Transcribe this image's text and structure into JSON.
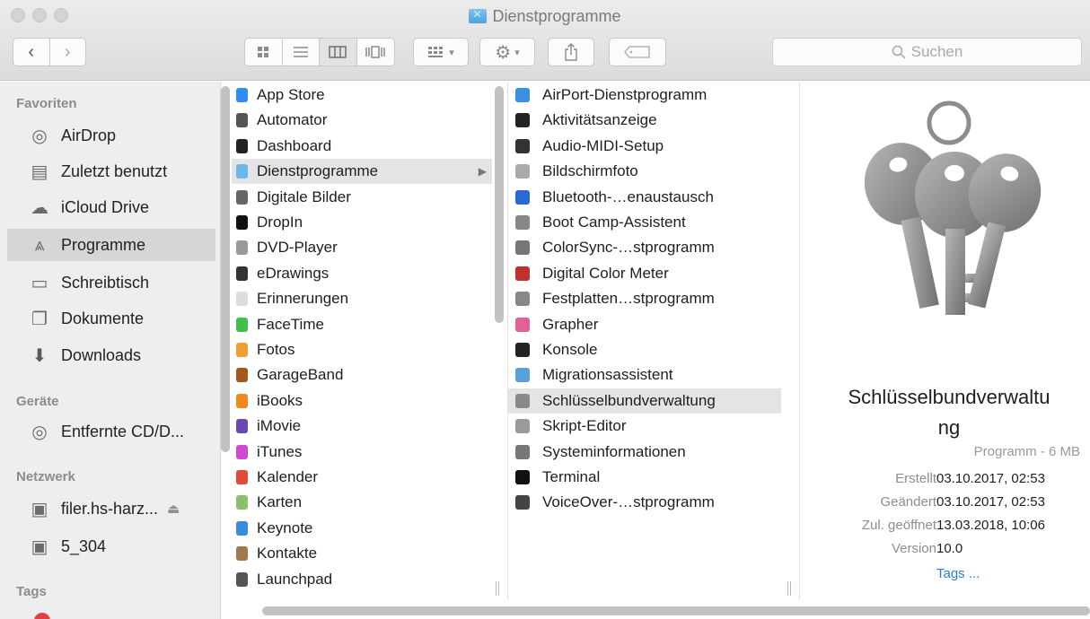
{
  "window": {
    "title": "Dienstprogramme"
  },
  "toolbar": {
    "search_placeholder": "Suchen",
    "view_modes": [
      "icon-view-icon",
      "list-view-icon",
      "column-view-icon",
      "coverflow-view-icon"
    ],
    "active_view": "column-view-icon"
  },
  "sidebar": {
    "sections": {
      "favorites": "Favoriten",
      "devices": "Geräte",
      "network": "Netzwerk",
      "tags": "Tags"
    },
    "favorites": [
      {
        "label": "AirDrop",
        "icon": "airdrop-icon"
      },
      {
        "label": "Zuletzt benutzt",
        "icon": "recents-icon"
      },
      {
        "label": "iCloud Drive",
        "icon": "cloud-icon"
      },
      {
        "label": "Programme",
        "icon": "applications-icon",
        "selected": true
      },
      {
        "label": "Schreibtisch",
        "icon": "desktop-icon"
      },
      {
        "label": "Dokumente",
        "icon": "documents-icon"
      },
      {
        "label": "Downloads",
        "icon": "downloads-icon"
      }
    ],
    "devices": [
      {
        "label": "Entfernte CD/D...",
        "icon": "disc-icon"
      }
    ],
    "network": [
      {
        "label": "filer.hs-harz...",
        "icon": "computer-icon",
        "eject": "⏏"
      },
      {
        "label": "5_304",
        "icon": "computer-icon"
      }
    ]
  },
  "column1": {
    "items": [
      {
        "label": "App Store",
        "color": "#2d8ef0"
      },
      {
        "label": "Automator",
        "color": "#555555"
      },
      {
        "label": "Dashboard",
        "color": "#222222"
      },
      {
        "label": "Dienstprogramme",
        "color": "#6ab7ea",
        "selected": true
      },
      {
        "label": "Digitale Bilder",
        "color": "#666666"
      },
      {
        "label": "DropIn",
        "color": "#111111"
      },
      {
        "label": "DVD-Player",
        "color": "#999999"
      },
      {
        "label": "eDrawings",
        "color": "#333333"
      },
      {
        "label": "Erinnerungen",
        "color": "#dddddd"
      },
      {
        "label": "FaceTime",
        "color": "#3fc04a"
      },
      {
        "label": "Fotos",
        "color": "#f0a030"
      },
      {
        "label": "GarageBand",
        "color": "#a05a20"
      },
      {
        "label": "iBooks",
        "color": "#f08a20"
      },
      {
        "label": "iMovie",
        "color": "#6a4ab0"
      },
      {
        "label": "iTunes",
        "color": "#d04ad0"
      },
      {
        "label": "Kalender",
        "color": "#e04a3a"
      },
      {
        "label": "Karten",
        "color": "#8ac06a"
      },
      {
        "label": "Keynote",
        "color": "#3a8ae0"
      },
      {
        "label": "Kontakte",
        "color": "#a0784a"
      },
      {
        "label": "Launchpad",
        "color": "#555555"
      }
    ]
  },
  "column2": {
    "items": [
      {
        "label": "AirPort-Dienstprogramm",
        "color": "#3a90e0"
      },
      {
        "label": "Aktivitätsanzeige",
        "color": "#222222"
      },
      {
        "label": "Audio-MIDI-Setup",
        "color": "#333333"
      },
      {
        "label": "Bildschirmfoto",
        "color": "#aaaaaa"
      },
      {
        "label": "Bluetooth-…enaustausch",
        "color": "#2a6ad0"
      },
      {
        "label": "Boot Camp-Assistent",
        "color": "#888888"
      },
      {
        "label": "ColorSync-…stprogramm",
        "color": "#777777"
      },
      {
        "label": "Digital Color Meter",
        "color": "#c03030"
      },
      {
        "label": "Festplatten…stprogramm",
        "color": "#888888"
      },
      {
        "label": "Grapher",
        "color": "#e0609a"
      },
      {
        "label": "Konsole",
        "color": "#222222"
      },
      {
        "label": "Migrationsassistent",
        "color": "#5aa0d8"
      },
      {
        "label": "Schlüsselbundverwaltung",
        "color": "#8a8a8a",
        "selected": true
      },
      {
        "label": "Skript-Editor",
        "color": "#9a9a9a"
      },
      {
        "label": "Systeminformationen",
        "color": "#777777"
      },
      {
        "label": "Terminal",
        "color": "#111111"
      },
      {
        "label": "VoiceOver-…stprogramm",
        "color": "#444444"
      }
    ]
  },
  "preview": {
    "name_line1": "Schlüsselbundverwaltu",
    "name_line2": "ng",
    "kind": "Programm - 6 MB",
    "meta": [
      {
        "key": "Erstellt",
        "value": "03.10.2017, 02:53"
      },
      {
        "key": "Geändert",
        "value": "03.10.2017, 02:53"
      },
      {
        "key": "Zul. geöffnet",
        "value": "13.03.2018, 10:06"
      },
      {
        "key": "Version",
        "value": "10.0"
      }
    ],
    "tags_link": "Tags ..."
  }
}
